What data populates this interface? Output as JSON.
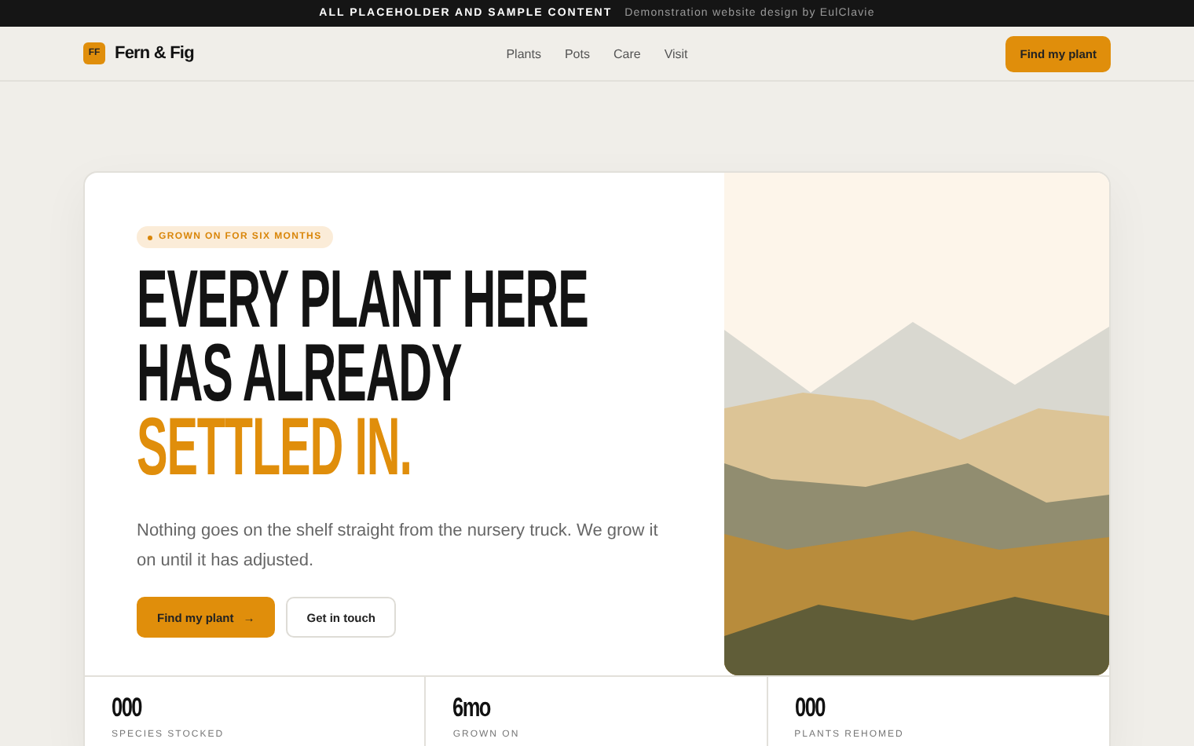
{
  "banner": {
    "title": "ALL PLACEHOLDER AND SAMPLE CONTENT",
    "note": "Demonstration website design by EulClavie"
  },
  "nav": {
    "logo_mark": "FF",
    "brand": "Fern & Fig",
    "links": [
      "Plants",
      "Pots",
      "Care",
      "Visit"
    ],
    "cta": "Find my plant"
  },
  "hero": {
    "badge": "GROWN ON FOR SIX MONTHS",
    "headline": [
      "EVERY PLANT HERE",
      "HAS ALREADY"
    ],
    "headline_accent": "SETTLED IN.",
    "body": "Nothing goes on the shelf straight from the nursery truck. We grow it on until it has adjusted.",
    "buttons": [
      {
        "label": "Find my plant",
        "arrow": "→",
        "kind": "primary"
      },
      {
        "label": "Get in touch",
        "kind": "secondary"
      }
    ]
  },
  "stats": [
    {
      "value": "000",
      "label": "SPECIES STOCKED"
    },
    {
      "value": "6mo",
      "label": "GROWN ON"
    },
    {
      "value": "000",
      "label": "PLANTS REHOMED"
    }
  ]
}
